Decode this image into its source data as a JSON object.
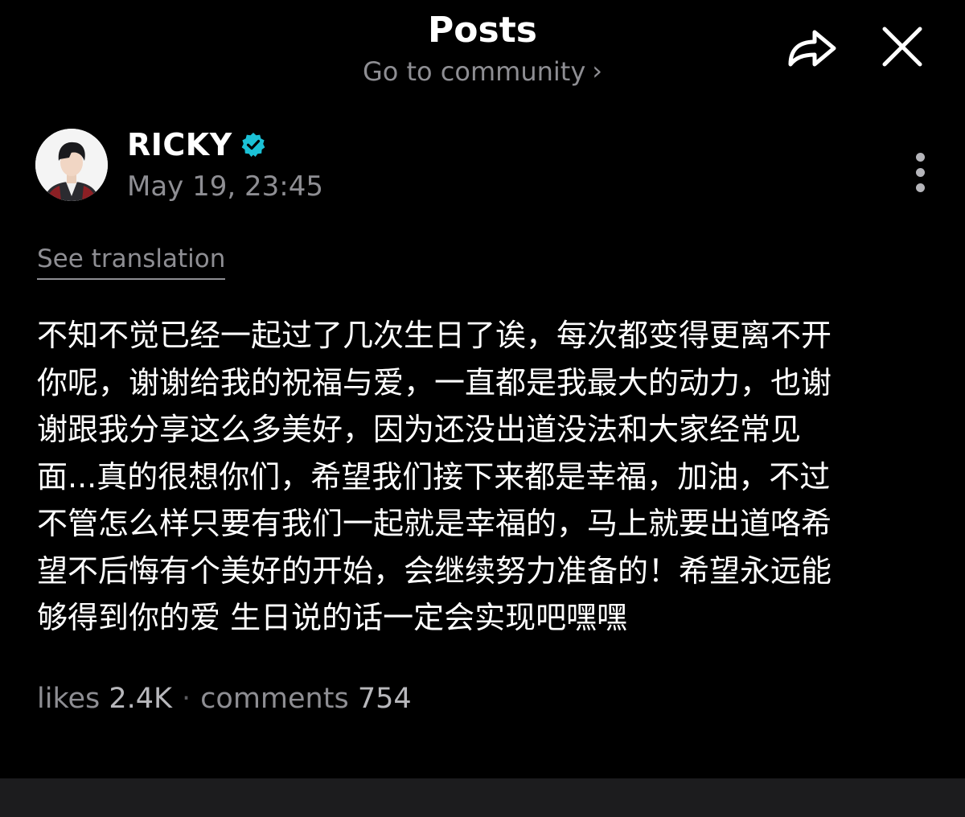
{
  "header": {
    "title": "Posts",
    "subtitle": "Go to community",
    "subtitle_chevron": "›",
    "icons": [
      "share-icon",
      "close-icon"
    ]
  },
  "post": {
    "author": {
      "name": "RICKY",
      "verified": true,
      "verified_color": "#1bc1d6"
    },
    "timestamp": "May 19, 23:45",
    "see_translation_label": "See translation",
    "body_lines": [
      "不知不觉已经一起过了几次生日了诶，每次都变得更离不开",
      "你呢，谢谢给我的祝福与爱，一直都是我最大的动力，也谢",
      "谢跟我分享这么多美好，因为还没出道没法和大家经常见",
      "面...真的很想你们，希望我们接下来都是幸福，加油，不过",
      "不管怎么样只要有我们一起就是幸福的，马上就要出道咯希",
      "望不后悔有个美好的开始，会继续努力准备的！希望永远能",
      "够得到你的爱 生日说的话一定会实现吧嘿嘿"
    ],
    "stats": {
      "likes_label": "likes",
      "likes_value": "2.4K",
      "separator": "·",
      "comments_label": "comments",
      "comments_value": "754"
    }
  },
  "colors": {
    "background": "#000000",
    "primary_text": "#ffffff",
    "secondary_text": "#8e8e93",
    "bottom_bar": "#1c1c1e"
  }
}
